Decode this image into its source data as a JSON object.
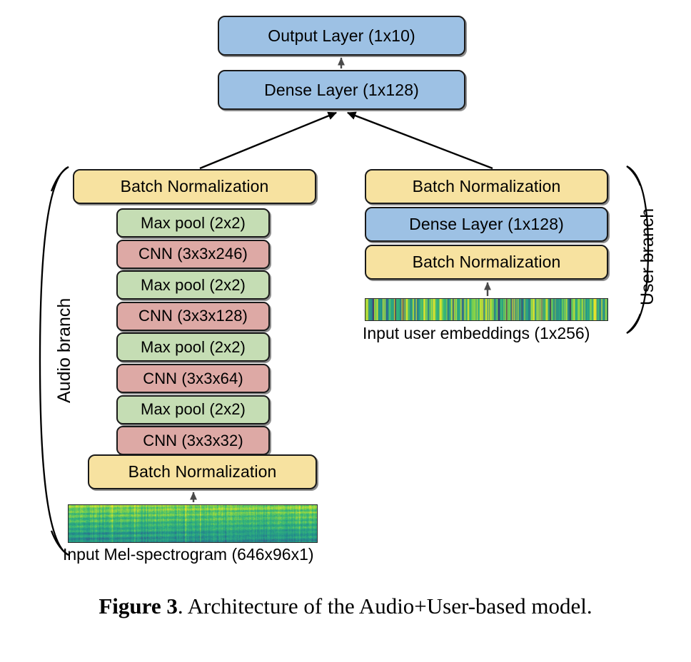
{
  "figure": {
    "caption_prefix": "Figure 3",
    "caption_text": ". Architecture of the Audio+User-based model."
  },
  "head": {
    "output_layer": "Output Layer (1x10)",
    "dense_layer": "Dense Layer (1x128)"
  },
  "audio_branch": {
    "brace_label": "Audio branch",
    "top_batch_norm": "Batch Normalization",
    "stack": [
      {
        "label": "Max pool (2x2)",
        "color": "green"
      },
      {
        "label": "CNN  (3x3x246)",
        "color": "red"
      },
      {
        "label": "Max pool (2x2)",
        "color": "green"
      },
      {
        "label": "CNN  (3x3x128)",
        "color": "red"
      },
      {
        "label": "Max pool (2x2)",
        "color": "green"
      },
      {
        "label": "CNN (3x3x64)",
        "color": "red"
      },
      {
        "label": "Max pool (2x2)",
        "color": "green"
      },
      {
        "label": "CNN  (3x3x32)",
        "color": "red"
      }
    ],
    "bottom_batch_norm": "Batch Normalization",
    "input_label": "Input Mel-spectrogram (646x96x1)",
    "input_image_name": "mel-spectrogram"
  },
  "user_branch": {
    "brace_label": "User branch",
    "top_batch_norm": "Batch Normalization",
    "dense_layer": "Dense Layer (1x128)",
    "bottom_batch_norm": "Batch Normalization",
    "input_label": "Input user embeddings (1x256)",
    "input_image_name": "user-embedding-vector"
  },
  "colors": {
    "blue": "#9dc1e4",
    "yellow": "#f7e2a0",
    "green": "#c5ddb4",
    "red": "#dda9a5",
    "outline": "#1a1a1a",
    "background": "#ffffff"
  }
}
